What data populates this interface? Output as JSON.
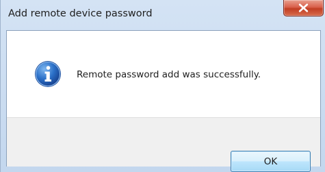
{
  "window": {
    "title": "Add remote device password",
    "close_icon": "close-icon"
  },
  "message": {
    "icon": "info-icon",
    "text": "Remote password add was successfully."
  },
  "buttons": {
    "ok_label": "OK"
  },
  "colors": {
    "titlebar": "#c8dbf0",
    "close_button": "#c8432a",
    "info_icon": "#1f5fb6",
    "footer": "#f0f0f0",
    "ok_button_border": "#3c7fb1"
  }
}
